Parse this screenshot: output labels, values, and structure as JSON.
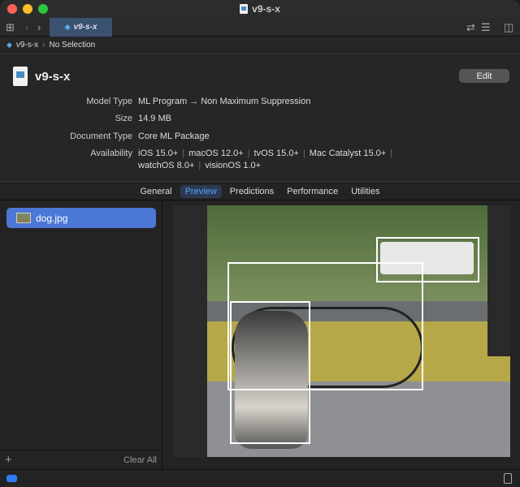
{
  "window": {
    "title": "v9-s-x"
  },
  "toolbar": {
    "tab_label": "v9-s-x"
  },
  "breadcrumb": {
    "model": "v9-s-x",
    "selection": "No Selection"
  },
  "header": {
    "title": "v9-s-x",
    "edit_label": "Edit",
    "model_type_label": "Model Type",
    "model_type": "ML Program → Non Maximum Suppression",
    "size_label": "Size",
    "size": "14.9 MB",
    "doc_type_label": "Document Type",
    "doc_type": "Core ML Package",
    "availability_label": "Availability",
    "availability": [
      "iOS 15.0+",
      "macOS 12.0+",
      "tvOS 15.0+",
      "Mac Catalyst 15.0+",
      "watchOS 8.0+",
      "visionOS 1.0+"
    ]
  },
  "tabs": [
    "General",
    "Preview",
    "Predictions",
    "Performance",
    "Utilities"
  ],
  "sidebar": {
    "file": "dog.jpg",
    "add": "+",
    "clear_all": "Clear All"
  },
  "colors": {
    "accent": "#4b78d4",
    "tab_active": "#5aa0ff"
  }
}
